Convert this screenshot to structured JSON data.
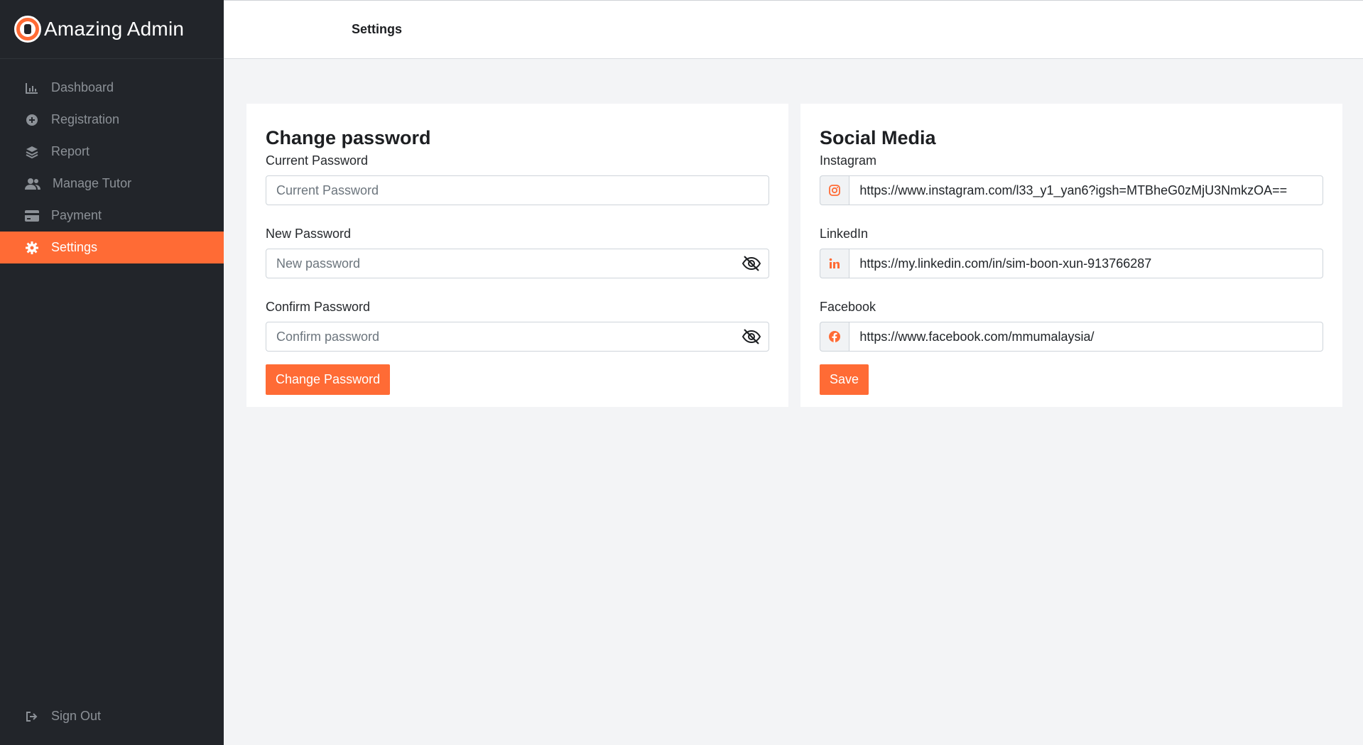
{
  "app": {
    "title": "Amazing Admin"
  },
  "sidebar": {
    "items": [
      {
        "label": "Dashboard",
        "icon": "chart-icon"
      },
      {
        "label": "Registration",
        "icon": "plus-circle-icon"
      },
      {
        "label": "Report",
        "icon": "layers-icon"
      },
      {
        "label": "Manage Tutor",
        "icon": "users-icon"
      },
      {
        "label": "Payment",
        "icon": "credit-card-icon"
      },
      {
        "label": "Settings",
        "icon": "gear-icon",
        "active": true
      }
    ],
    "signout": {
      "label": "Sign Out",
      "icon": "sign-out-icon"
    }
  },
  "header": {
    "title": "Settings"
  },
  "password_card": {
    "title": "Change password",
    "current": {
      "label": "Current Password",
      "placeholder": "Current Password"
    },
    "new": {
      "label": "New Password",
      "placeholder": "New password"
    },
    "confirm": {
      "label": "Confirm Password",
      "placeholder": "Confirm password"
    },
    "button": "Change Password"
  },
  "social_card": {
    "title": "Social Media",
    "instagram": {
      "label": "Instagram",
      "value": "https://www.instagram.com/l33_y1_yan6?igsh=MTBheG0zMjU3NmkzOA=="
    },
    "linkedin": {
      "label": "LinkedIn",
      "value": "https://my.linkedin.com/in/sim-boon-xun-913766287"
    },
    "facebook": {
      "label": "Facebook",
      "value": "https://www.facebook.com/mmumalaysia/"
    },
    "button": "Save"
  },
  "colors": {
    "accent": "#ff6b35",
    "sidebar_bg": "#22252a",
    "page_bg": "#f3f4f6"
  }
}
